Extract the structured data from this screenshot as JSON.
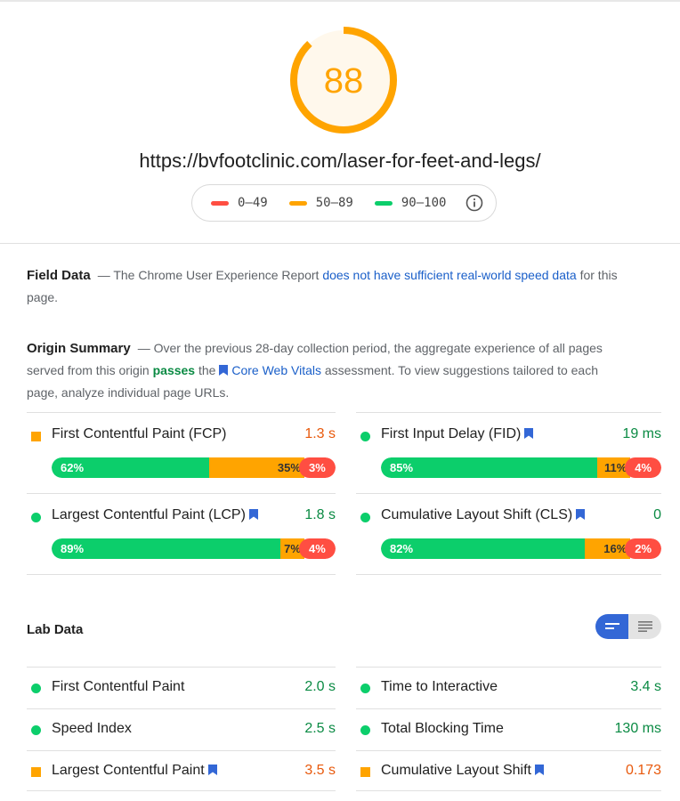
{
  "colors": {
    "good": "#0cce6b",
    "average": "#ffa400",
    "poor": "#ff4e42",
    "link": "#1a5fc9",
    "toggle_active": "#3367d6"
  },
  "gauge": {
    "score": "88",
    "fraction": 0.88
  },
  "url": "https://bvfootclinic.com/laser-for-feet-and-legs/",
  "legend": [
    {
      "label": "0–49",
      "color": "#ff4e42"
    },
    {
      "label": "50–89",
      "color": "#ffa400"
    },
    {
      "label": "90–100",
      "color": "#0cce6b"
    }
  ],
  "field_data": {
    "heading": "Field Data",
    "text_before": "— The Chrome User Experience Report ",
    "link": "does not have sufficient real-world speed data",
    "text_after": " for this page."
  },
  "origin_summary": {
    "heading": "Origin Summary",
    "text_1": "— Over the previous 28-day collection period, the aggregate experience of all pages served from this origin ",
    "passes": "passes",
    "text_2": " the ",
    "link": "Core Web Vitals",
    "text_3": " assessment. To view suggestions tailored to each page, analyze individual page URLs."
  },
  "field_metrics": [
    {
      "title": "First Contentful Paint (FCP)",
      "value": "1.3 s",
      "status": "average",
      "core": false,
      "good": "62%",
      "avg": "35%",
      "poor": "3%"
    },
    {
      "title": "First Input Delay (FID)",
      "value": "19 ms",
      "status": "good",
      "core": true,
      "good": "85%",
      "avg": "11%",
      "poor": "4%"
    },
    {
      "title": "Largest Contentful Paint (LCP)",
      "value": "1.8 s",
      "status": "good",
      "core": true,
      "good": "89%",
      "avg": "7%",
      "poor": "4%"
    },
    {
      "title": "Cumulative Layout Shift (CLS)",
      "value": "0",
      "status": "good",
      "core": true,
      "good": "82%",
      "avg": "16%",
      "poor": "2%"
    }
  ],
  "lab_data": {
    "heading": "Lab Data",
    "toggle_icons": [
      "list-compact-icon",
      "list-expanded-icon"
    ],
    "metrics": [
      {
        "title": "First Contentful Paint",
        "value": "2.0 s",
        "status": "good",
        "core": false
      },
      {
        "title": "Time to Interactive",
        "value": "3.4 s",
        "status": "good",
        "core": false
      },
      {
        "title": "Speed Index",
        "value": "2.5 s",
        "status": "good",
        "core": false
      },
      {
        "title": "Total Blocking Time",
        "value": "130 ms",
        "status": "good",
        "core": false
      },
      {
        "title": "Largest Contentful Paint",
        "value": "3.5 s",
        "status": "average",
        "core": true
      },
      {
        "title": "Cumulative Layout Shift",
        "value": "0.173",
        "status": "average",
        "core": true
      }
    ]
  }
}
